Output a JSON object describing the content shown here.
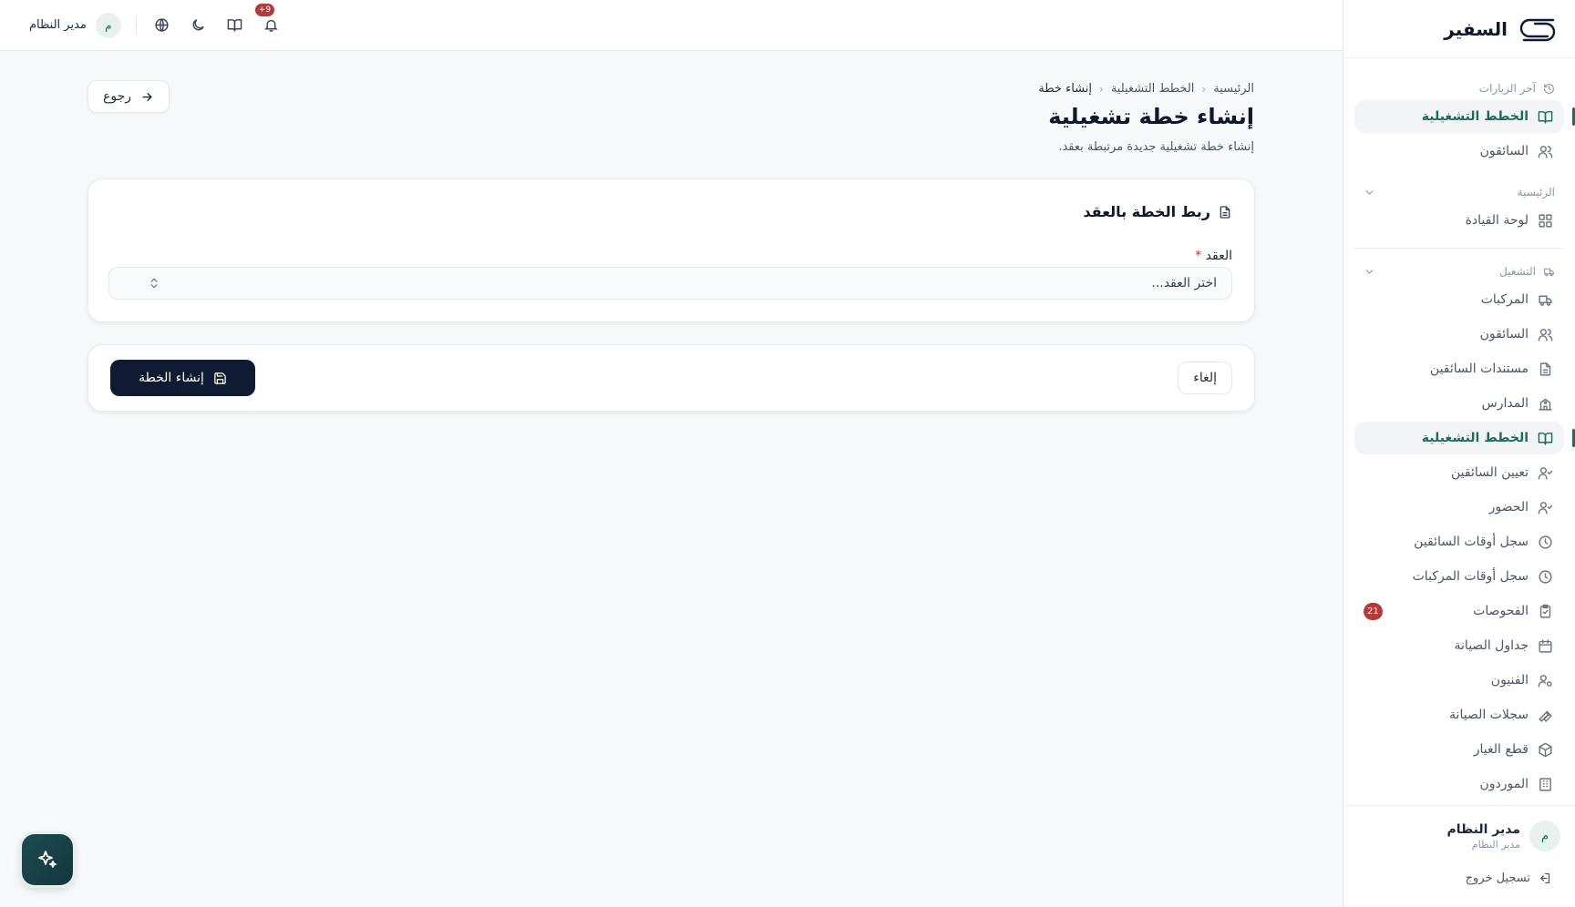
{
  "brand": {
    "name": "السفير"
  },
  "topbar": {
    "notifications_badge": "+9",
    "user_avatar": "م",
    "user_name": "مدير النظام"
  },
  "sidebar": {
    "recent": {
      "header": "آخر الزيارات",
      "items": [
        {
          "label": "الخطط التشغيلية",
          "icon": "book-open-icon",
          "active": true
        },
        {
          "label": "السائقون",
          "icon": "users-icon",
          "active": false
        }
      ]
    },
    "home": {
      "header": "الرئيسية",
      "items": [
        {
          "label": "لوحة القيادة",
          "icon": "grid-icon"
        }
      ]
    },
    "operations": {
      "header": "التشغيل",
      "items": [
        {
          "label": "المركبات",
          "icon": "truck-icon"
        },
        {
          "label": "السائقون",
          "icon": "users-icon"
        },
        {
          "label": "مستندات السائقين",
          "icon": "file-text-icon"
        },
        {
          "label": "المدارس",
          "icon": "school-icon"
        },
        {
          "label": "الخطط التشغيلية",
          "icon": "book-open-icon",
          "active": true
        },
        {
          "label": "تعيين السائقين",
          "icon": "user-check-icon"
        },
        {
          "label": "الحضور",
          "icon": "user-check-icon"
        },
        {
          "label": "سجل أوقات السائقين",
          "icon": "clock-icon"
        },
        {
          "label": "سجل أوقات المركبات",
          "icon": "clock-icon"
        },
        {
          "label": "الفحوصات",
          "icon": "clipboard-check-icon",
          "badge": "21"
        },
        {
          "label": "جداول الصيانة",
          "icon": "calendar-icon"
        },
        {
          "label": "الفنيون",
          "icon": "user-cog-icon"
        },
        {
          "label": "سجلات الصيانة",
          "icon": "wrench-icon"
        },
        {
          "label": "قطع الغيار",
          "icon": "package-icon"
        },
        {
          "label": "الموردون",
          "icon": "building-icon"
        }
      ]
    },
    "footer": {
      "avatar": "م",
      "name": "مدير النظام",
      "role": "مدير النظام",
      "logout": "تسجيل خروج"
    }
  },
  "page": {
    "breadcrumb": [
      "الرئيسية",
      "الخطط التشغيلية",
      "إنشاء خطة"
    ],
    "title": "إنشاء خطة تشغيلية",
    "description": "إنشاء خطة تشغيلية جديدة مرتبطة بعقد.",
    "back_label": "رجوع"
  },
  "contract_card": {
    "title": "ربط الخطة بالعقد",
    "field_label": "العقد",
    "required_mark": "*",
    "select_placeholder": "اختر العقد..."
  },
  "actions": {
    "cancel_label": "إلغاء",
    "create_label": "إنشاء الخطة"
  },
  "colors": {
    "accent": "#1f6b5c",
    "primary_button": "#0f1a33",
    "badge": "#b33a3a"
  }
}
